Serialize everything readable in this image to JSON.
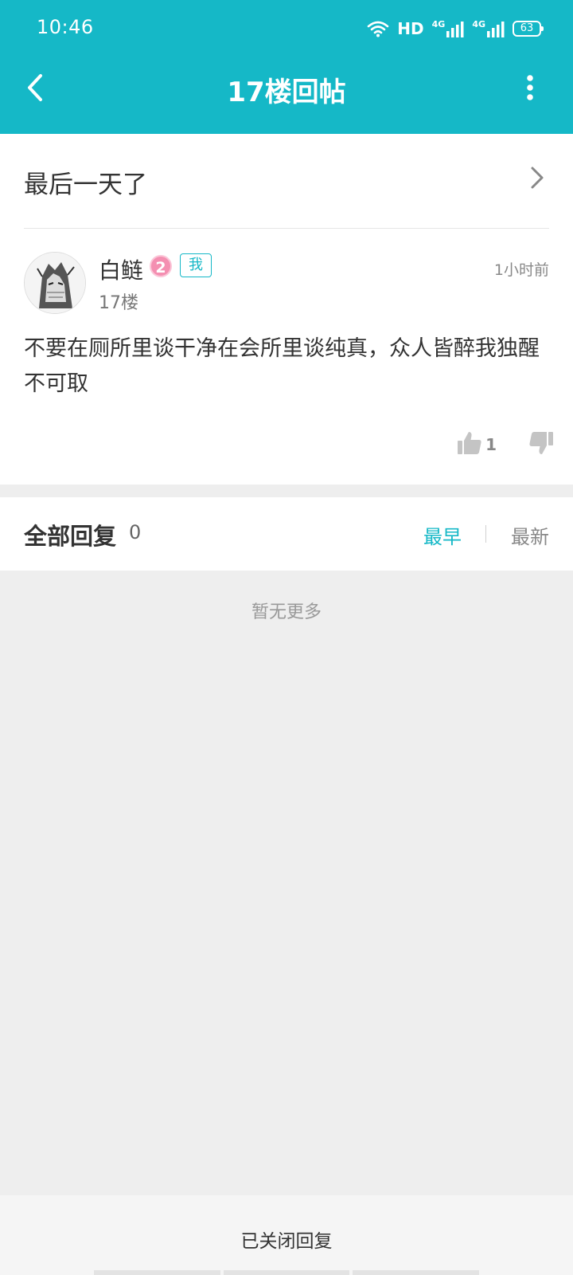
{
  "status_bar": {
    "time": "10:46",
    "hd_label": "HD",
    "network_1": "4G",
    "network_2": "4G",
    "battery": "63"
  },
  "header": {
    "title": "17楼回帖"
  },
  "thread": {
    "title": "最后一天了"
  },
  "post": {
    "author": "白鲢",
    "level": "2",
    "me_tag": "我",
    "floor": "17楼",
    "time": "1小时前",
    "content": "不要在厕所里谈干净在会所里谈纯真，众人皆醉我独醒不可取",
    "like_count": "1"
  },
  "replies": {
    "label": "全部回复",
    "count": "0",
    "sort_earliest": "最早",
    "sort_latest": "最新",
    "empty_text": "暂无更多"
  },
  "bottom": {
    "reply_closed": "已关闭回复"
  },
  "colors": {
    "accent": "#15b8c7",
    "level_badge": "#f48fb1"
  }
}
